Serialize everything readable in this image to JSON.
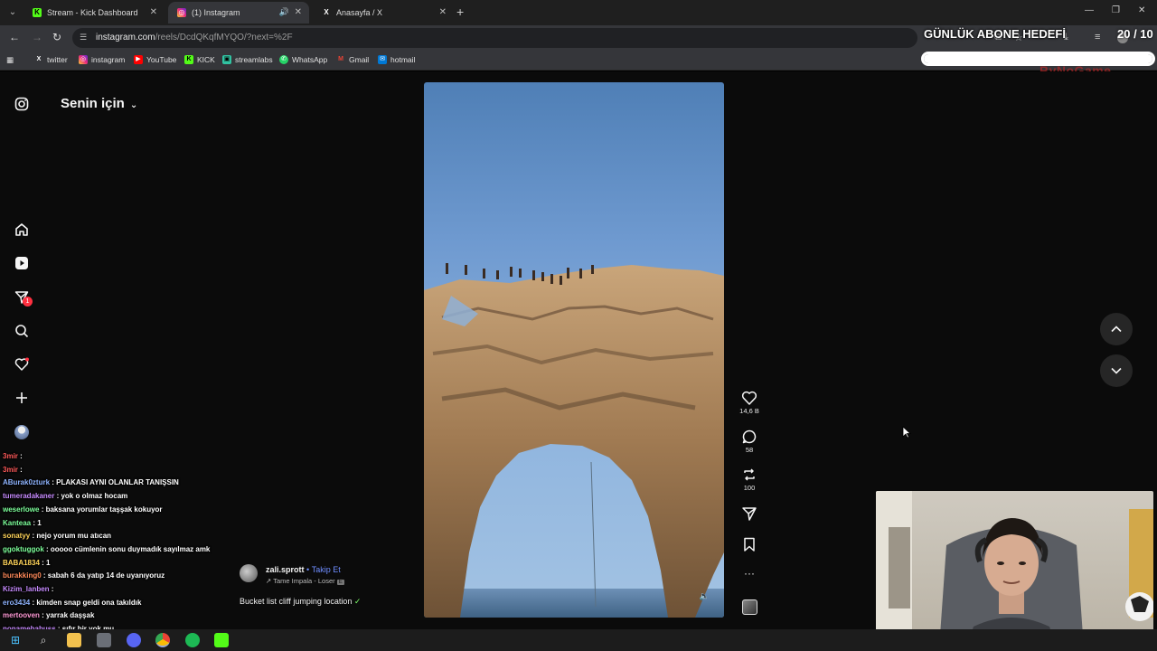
{
  "browser": {
    "tabs": [
      {
        "title": "Stream - Kick Dashboard",
        "favicon": "kick-icon",
        "color": "#53fc18"
      },
      {
        "title": "(1) Instagram",
        "favicon": "instagram-icon",
        "color": "#e1306c"
      },
      {
        "title": "Anasayfa / X",
        "favicon": "x-icon",
        "color": "#ffffff"
      }
    ],
    "url_host": "instagram.com",
    "url_path": "/reels/DcdQKqfMYQO/?next=%2F",
    "bookmarks": [
      {
        "label": "twitter",
        "icon": "x-icon"
      },
      {
        "label": "instagram",
        "icon": "instagram-icon"
      },
      {
        "label": "YouTube",
        "icon": "youtube-icon"
      },
      {
        "label": "KICK",
        "icon": "kick-icon"
      },
      {
        "label": "streamlabs",
        "icon": "streamlabs-icon"
      },
      {
        "label": "WhatsApp",
        "icon": "whatsapp-icon"
      },
      {
        "label": "Gmail",
        "icon": "gmail-icon"
      },
      {
        "label": "hotmail",
        "icon": "hotmail-icon"
      }
    ]
  },
  "overlay": {
    "goal_title": "GÜNLÜK ABONE HEDEFİ",
    "goal_count": "20 / 10",
    "goal_progress": 1.0,
    "brand": "ByNoGame"
  },
  "instagram": {
    "heading": "Senin için",
    "sidebar_icons": [
      "instagram-icon",
      "home-icon",
      "reels-icon",
      "messages-icon",
      "search-icon",
      "notifications-icon",
      "create-icon",
      "profile-avatar"
    ],
    "messages_badge": "1",
    "reel": {
      "username": "zali.sprott",
      "follow_label": "Takip Et",
      "separator": "•",
      "music": "Tame Impala - Loser",
      "music_badge": "E",
      "caption": "Bucket list cliff jumping location",
      "caption_emoji": "✓"
    },
    "actions": {
      "likes": "14,6 B",
      "comments": "58",
      "reposts": "100"
    },
    "accent": "#6f8dff",
    "badge_color": "#ff3040"
  },
  "chat": [
    {
      "user": "3mir",
      "msg": "",
      "color": "#ff5a5a"
    },
    {
      "user": "3mir",
      "msg": "",
      "color": "#ff5a5a"
    },
    {
      "user": "ABurak0zturk",
      "msg": "PLAKASI AYNI OLANLAR TANIŞSIN",
      "color": "#8fb4ff"
    },
    {
      "user": "tumeradakaner",
      "msg": "yok o olmaz hocam",
      "color": "#c78bff"
    },
    {
      "user": "weserlowe",
      "msg": "baksana yorumlar taşşak kokuyor",
      "color": "#7dff9a"
    },
    {
      "user": "Kanteaa",
      "msg": "1",
      "color": "#7dff9a"
    },
    {
      "user": "sonatyy",
      "msg": "nejo yorum mu atıcan",
      "color": "#ffd45a"
    },
    {
      "user": "ggoktuggok",
      "msg": "ooooo cümlenin sonu duymadık sayılmaz amk",
      "color": "#7dff9a"
    },
    {
      "user": "BABA1834",
      "msg": "1",
      "color": "#ffd45a"
    },
    {
      "user": "burakking0",
      "msg": "sabah 6 da yatıp 14 de uyanıyoruz",
      "color": "#ff8a5a"
    },
    {
      "user": "Kizim_lanben",
      "msg": "",
      "color": "#c78bff"
    },
    {
      "user": "ero3434",
      "msg": "kimden snap geldi ona takıldık",
      "color": "#8fb4ff"
    },
    {
      "user": "mertooven",
      "msg": "yarrak daşşak",
      "color": "#ff9ad5"
    },
    {
      "user": "nonamebabuss",
      "msg": "sıfır bir yok mu",
      "color": "#c78bff"
    }
  ]
}
